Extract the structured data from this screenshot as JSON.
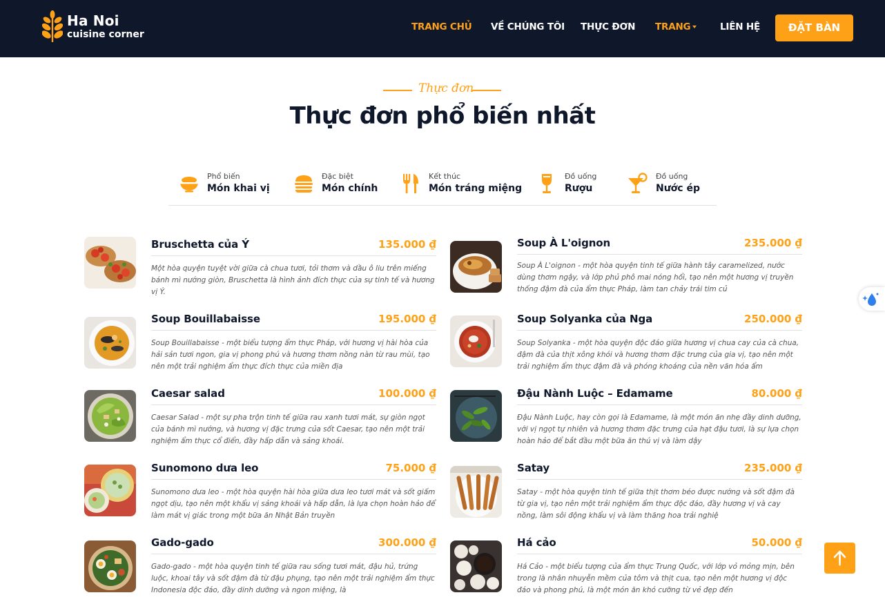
{
  "brand": {
    "title": "Ha Noi",
    "subtitle": "cuisine corner"
  },
  "nav": {
    "links": [
      "TRANG CHỦ",
      "VỀ CHÚNG TÔI",
      "THỰC ĐƠN",
      "TRANG",
      "LIÊN HỆ"
    ],
    "active": "TRANG CHỦ",
    "book_label": "ĐẶT BÀN"
  },
  "section": {
    "tag": "Thực đơn",
    "title": "Thực đơn phổ biến nhất"
  },
  "tabs": [
    {
      "small": "Phổ biến",
      "big": "Món khai vị",
      "icon": "bowl-icon"
    },
    {
      "small": "Đặc biệt",
      "big": "Món chính",
      "icon": "hamburger-icon"
    },
    {
      "small": "Kết thúc",
      "big": "Món tráng miệng",
      "icon": "utensils-icon"
    },
    {
      "small": "Đồ uống",
      "big": "Rượu",
      "icon": "wine-glass-icon"
    },
    {
      "small": "Đồ uống",
      "big": "Nước ép",
      "icon": "cocktail-icon"
    }
  ],
  "items": [
    {
      "name": "Bruschetta của Ý",
      "price": "135.000 ₫",
      "desc": "Một hòa quyện tuyệt vời giữa cà chua tươi, tỏi thơm và dầu ô liu trên miếng bánh mì nướng giòn, Bruschetta là hình ảnh đích thực của sự tinh tế và hương vị Ý."
    },
    {
      "name": "Soup À L'oignon",
      "price": "235.000 ₫",
      "desc": "Soup À L'oignon - một hòa quyện tinh tế giữa hành tây caramelized, nước dùng thơm ngậy, và lớp phủ phô mai nóng hổi, tạo nên một hương vị truyền thống đậm đà của ẩm thực Pháp, làm tan chảy trái tim củ"
    },
    {
      "name": "Soup Bouillabaisse",
      "price": "195.000 ₫",
      "desc": "Soup Bouillabaisse - một biểu tượng ẩm thực Pháp, với hương vị hài hòa của hải sản tươi ngon, gia vị phong phú và hương thơm nồng nàn từ rau mùi, tạo nên một trải nghiệm ẩm thực đích thực của miền địa"
    },
    {
      "name": "Soup Solyanka của Nga",
      "price": "250.000 ₫",
      "desc": "Soup Solyanka - một hòa quyện độc đáo giữa hương vị chua cay của cà chua, đậm đà của thịt xông khói và hương thơm đặc trưng của gia vị, tạo nên một trải nghiệm ẩm thực đậm đà và phóng khoáng của nền văn hóa ẩm"
    },
    {
      "name": "Caesar salad",
      "price": "100.000 ₫",
      "desc": "Caesar Salad - một sự pha trộn tinh tế giữa rau xanh tươi mát, sự giòn ngọt của bánh mì nướng, và hương vị đặc trưng của sốt Caesar, tạo nên một trải nghiệm ẩm thực cổ điển, đầy hấp dẫn và sảng khoái."
    },
    {
      "name": "Đậu Nành Luộc – Edamame",
      "price": "80.000 ₫",
      "desc": "Đậu Nành Luộc, hay còn gọi là Edamame, là một món ăn nhẹ đầy dinh dưỡng, với vị ngọt tự nhiên và hương thơm đặc trưng của hạt đậu tươi, là sự lựa chọn hoàn hảo để bắt đầu một bữa ăn thú vị và làm dậy"
    },
    {
      "name": "Sunomono dưa leo",
      "price": "75.000 ₫",
      "desc": "Sunomono dưa leo - một hòa quyện hài hòa giữa dưa leo tươi mát và sốt giấm ngọt dịu, tạo nên một khẩu vị sảng khoái và hấp dẫn, là lựa chọn hoàn hảo để làm mát vị giác trong một bữa ăn Nhật Bản truyền"
    },
    {
      "name": "Satay",
      "price": "235.000 ₫",
      "desc": "Satay - một hòa quyện tinh tế giữa thịt thơm béo được nướng và sốt đậm đà từ gia vị, tạo nên một trải nghiệm ẩm thực độc đáo, đầy hương vị và cay nồng, làm sôi động khẩu vị và làm thăng hoa trải nghiệ"
    },
    {
      "name": "Gado-gado",
      "price": "300.000 ₫",
      "desc": "Gado-gado - một hòa quyện tinh tế giữa rau sống tươi mát, đậu hủ, trứng luộc, khoai tây và sốt đậm đà từ đậu phụng, tạo nên một trải nghiệm ẩm thực Indonesia độc đáo, đầy dinh dưỡng và ngon miệng, là"
    },
    {
      "name": "Há cảo",
      "price": "50.000 ₫",
      "desc": "Há Cảo - một biểu tượng của ẩm thực Trung Quốc, với lớp vỏ mỏng mịn, bên trong là nhân nhuyễn mềm của tôm và thịt cua, tạo nên một hương vị độc đáo và phong phú, là một món ăn khó cưỡng từ vẻ đẹp đến"
    }
  ],
  "colors": {
    "primary": "#fea116",
    "dark": "#0f172b"
  }
}
